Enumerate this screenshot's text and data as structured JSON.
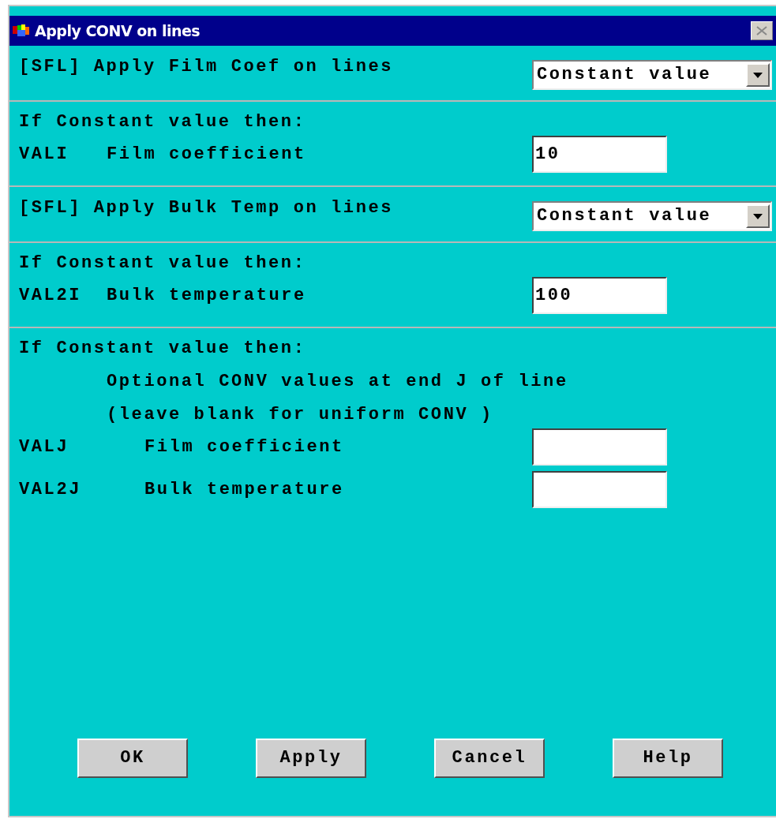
{
  "window": {
    "title": "Apply CONV on lines"
  },
  "sections": [
    {
      "kind": "select",
      "label": "[SFL] Apply Film Coef on lines",
      "value": "Constant value"
    },
    {
      "kind": "fields",
      "heading": "If Constant value then:",
      "rows": [
        {
          "code": "VALI",
          "label": "Film coefficient",
          "value": "10"
        }
      ]
    },
    {
      "kind": "select",
      "label": "[SFL] Apply Bulk Temp on lines",
      "value": "Constant value"
    },
    {
      "kind": "fields",
      "heading": "If Constant value then:",
      "rows": [
        {
          "code": "VAL2I",
          "label": "Bulk temperature",
          "value": "100"
        }
      ]
    },
    {
      "kind": "fields",
      "heading": "If Constant value then:",
      "notes": [
        "Optional CONV values at end J of line",
        "(leave blank for uniform CONV )"
      ],
      "rows": [
        {
          "code": "VALJ",
          "label": "Film coefficient"
        },
        {
          "code": "VAL2J",
          "label": "Bulk temperature"
        }
      ]
    }
  ],
  "buttons": [
    "OK",
    "Apply",
    "Cancel",
    "Help"
  ]
}
